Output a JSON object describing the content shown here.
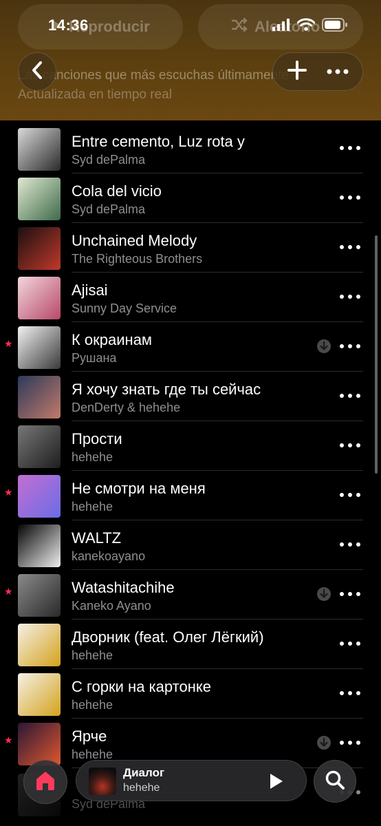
{
  "status_bar": {
    "time": "14:36",
    "icons": [
      "signal-icon",
      "wifi-icon",
      "battery-icon"
    ]
  },
  "header": {
    "play_label": "Reproducir",
    "shuffle_label": "Aleatorio",
    "description": "Las canciones que más escuchas últimamente",
    "subtitle": "Actualizada en tiempo real",
    "accent_color": "#6a4712"
  },
  "tracks": [
    {
      "title": "Entre cemento, Luz rota y",
      "artist": "Syd dePalma",
      "favorite": false,
      "downloaded": false,
      "cover": [
        "#d9d9d9",
        "#2b2b2b"
      ]
    },
    {
      "title": "Cola del vicio",
      "artist": "Syd dePalma",
      "favorite": false,
      "downloaded": false,
      "cover": [
        "#dfe8d0",
        "#3f6b4a"
      ]
    },
    {
      "title": "Unchained Melody",
      "artist": "The Righteous Brothers",
      "favorite": false,
      "downloaded": false,
      "cover": [
        "#1a1010",
        "#c0392b"
      ]
    },
    {
      "title": "Ajisai",
      "artist": "Sunny Day Service",
      "favorite": false,
      "downloaded": false,
      "cover": [
        "#f1d6dc",
        "#b8486a"
      ]
    },
    {
      "title": "К окраинам",
      "artist": "Рушана",
      "favorite": true,
      "downloaded": true,
      "cover": [
        "#f2f2f2",
        "#3a3a3a"
      ]
    },
    {
      "title": "Я хочу знать где ты сейчас",
      "artist": "DenDerty & hehehe",
      "favorite": false,
      "downloaded": false,
      "cover": [
        "#2c3a5a",
        "#c27a6a"
      ]
    },
    {
      "title": "Прости",
      "artist": "hehehe",
      "favorite": false,
      "downloaded": false,
      "cover": [
        "#777777",
        "#1e1e1e"
      ]
    },
    {
      "title": "Не смотри на меня",
      "artist": "hehehe",
      "favorite": true,
      "downloaded": false,
      "cover": [
        "#c46fd1",
        "#6a6ce6"
      ]
    },
    {
      "title": "WALTZ",
      "artist": "kanekoayano",
      "favorite": false,
      "downloaded": false,
      "cover": [
        "#050505",
        "#f0f0f0"
      ]
    },
    {
      "title": "Watashitachihe",
      "artist": "Kaneko Ayano",
      "favorite": true,
      "downloaded": true,
      "cover": [
        "#8a8a8a",
        "#2a2a2a"
      ]
    },
    {
      "title": "Дворник (feat. Олег Лёгкий)",
      "artist": "hehehe",
      "favorite": false,
      "downloaded": false,
      "cover": [
        "#f4f0e6",
        "#d4a21c"
      ]
    },
    {
      "title": "С горки на картонке",
      "artist": "hehehe",
      "favorite": false,
      "downloaded": false,
      "cover": [
        "#f4f0e6",
        "#d4a21c"
      ]
    },
    {
      "title": "Ярче",
      "artist": "hehehe",
      "favorite": true,
      "downloaded": true,
      "cover": [
        "#2b1736",
        "#e0572e"
      ]
    }
  ],
  "peek_track": {
    "artist": "Syd dePalma"
  },
  "mini_player": {
    "title": "Диалог",
    "artist": "hehehe"
  },
  "bottom_bar": {
    "home_icon": "home-icon",
    "search_icon": "search-icon",
    "home_color": "#ff3b5c"
  }
}
